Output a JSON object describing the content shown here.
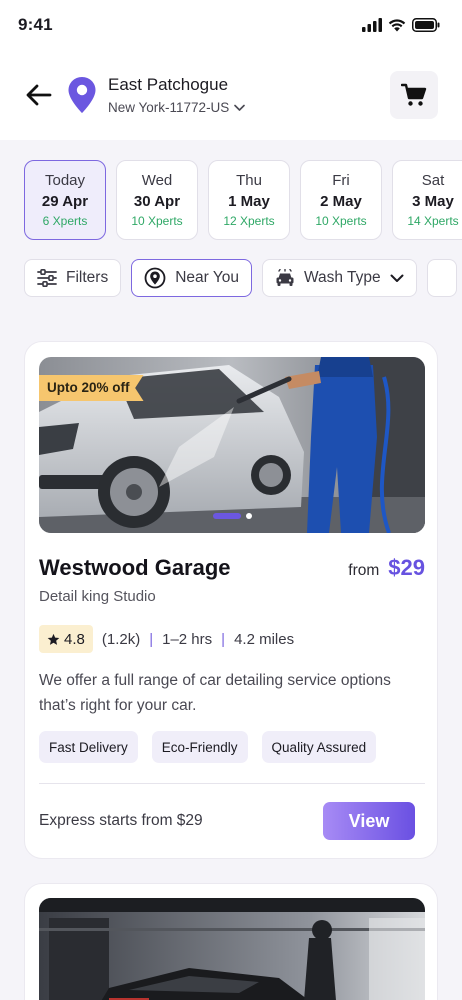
{
  "status_bar": {
    "time": "9:41"
  },
  "header": {
    "location_name": "East Patchogue",
    "location_sub": "New York-11772-US"
  },
  "dates": [
    {
      "day": "Today",
      "date": "29 Apr",
      "xperts": "6 Xperts",
      "active": true
    },
    {
      "day": "Wed",
      "date": "30 Apr",
      "xperts": "10 Xperts",
      "active": false
    },
    {
      "day": "Thu",
      "date": "1 May",
      "xperts": "12 Xperts",
      "active": false
    },
    {
      "day": "Fri",
      "date": "2 May",
      "xperts": "10 Xperts",
      "active": false
    },
    {
      "day": "Sat",
      "date": "3 May",
      "xperts": "14 Xperts",
      "active": false
    }
  ],
  "filters": {
    "filters_label": "Filters",
    "near_you_label": "Near You",
    "wash_type_label": "Wash Type"
  },
  "listing": {
    "offer_badge": "Upto 20% off",
    "name": "Westwood Garage",
    "from_label": "from",
    "price": "$29",
    "studio": "Detail king Studio",
    "rating": "4.8",
    "reviews": "(1.2k)",
    "duration": "1–2 hrs",
    "distance": "4.2 miles",
    "description": "We offer a full range of car detailing service options that’s right for your car.",
    "tags": [
      "Fast Delivery",
      "Eco-Friendly",
      "Quality Assured"
    ],
    "express_text": "Express starts from $29",
    "view_label": "View"
  },
  "colors": {
    "accent": "#6752e0",
    "xperts_green": "#2fa866",
    "badge_yellow": "#f6c66e"
  }
}
